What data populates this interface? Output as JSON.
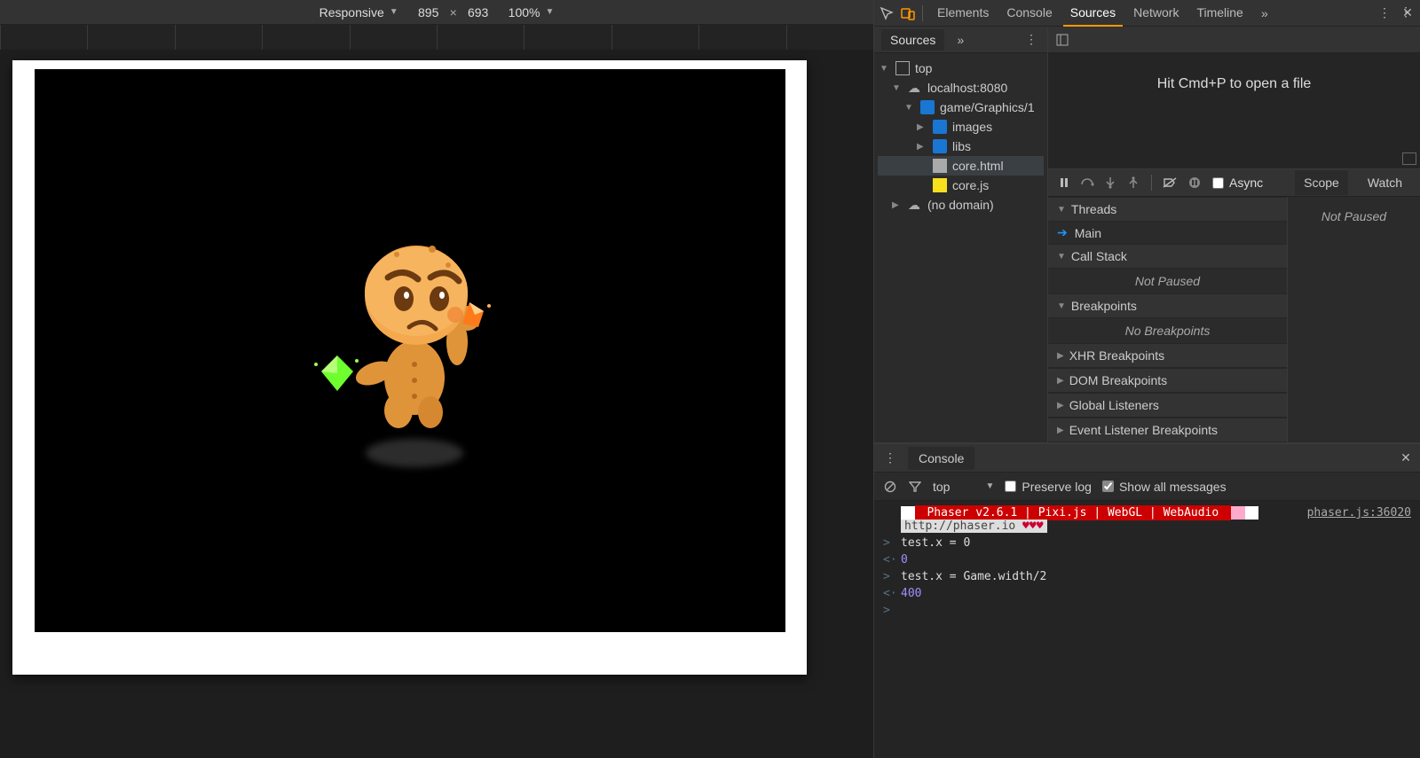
{
  "device_bar": {
    "mode": "Responsive",
    "w": "895",
    "x": "×",
    "h": "693",
    "zoom": "100%"
  },
  "devtools_tabs": [
    "Elements",
    "Console",
    "Sources",
    "Network",
    "Timeline"
  ],
  "devtools_tabs_active": "Sources",
  "sources_panel": {
    "sources_tab": "Sources",
    "tree": [
      {
        "depth": 0,
        "open": true,
        "icon": "frame",
        "label": "top"
      },
      {
        "depth": 1,
        "open": true,
        "icon": "cloud",
        "label": "localhost:8080"
      },
      {
        "depth": 2,
        "open": true,
        "icon": "folder",
        "label": "game/Graphics/1"
      },
      {
        "depth": 3,
        "open": false,
        "icon": "folder",
        "label": "images"
      },
      {
        "depth": 3,
        "open": false,
        "icon": "folder",
        "label": "libs"
      },
      {
        "depth": 3,
        "open": null,
        "icon": "html",
        "label": "core.html",
        "sel": true
      },
      {
        "depth": 3,
        "open": null,
        "icon": "js",
        "label": "core.js"
      },
      {
        "depth": 1,
        "open": false,
        "icon": "cloud",
        "label": "(no domain)"
      }
    ],
    "editor_hint": "Hit Cmd+P to open a file"
  },
  "debugger": {
    "async_label": "Async",
    "scope_tab": "Scope",
    "watch_tab": "Watch",
    "sections": {
      "threads": {
        "title": "Threads",
        "main": "Main"
      },
      "callstack": {
        "title": "Call Stack",
        "body": "Not Paused"
      },
      "breakpoints": {
        "title": "Breakpoints",
        "body": "No Breakpoints"
      },
      "xhr": {
        "title": "XHR Breakpoints"
      },
      "dom": {
        "title": "DOM Breakpoints"
      },
      "global": {
        "title": "Global Listeners"
      },
      "eventlistener": {
        "title": "Event Listener Breakpoints"
      }
    },
    "scope_body": "Not Paused"
  },
  "console": {
    "tab": "Console",
    "context": "top",
    "preserve_log": "Preserve log",
    "show_all": "Show all messages",
    "banner": " Phaser v2.6.1 | Pixi.js | WebGL | WebAudio ",
    "banner_url": "http://phaser.io",
    "banner_hearts": " ♥♥♥",
    "banner_link": "phaser.js:36020",
    "lines": [
      {
        "g": ">",
        "t": "test.x = 0",
        "cls": "code"
      },
      {
        "g": "<·",
        "t": "0",
        "cls": "num"
      },
      {
        "g": ">",
        "t": "test.x = Game.width/2",
        "cls": "code"
      },
      {
        "g": "<·",
        "t": "400",
        "cls": "num"
      },
      {
        "g": ">",
        "t": "",
        "cls": "code"
      }
    ]
  }
}
